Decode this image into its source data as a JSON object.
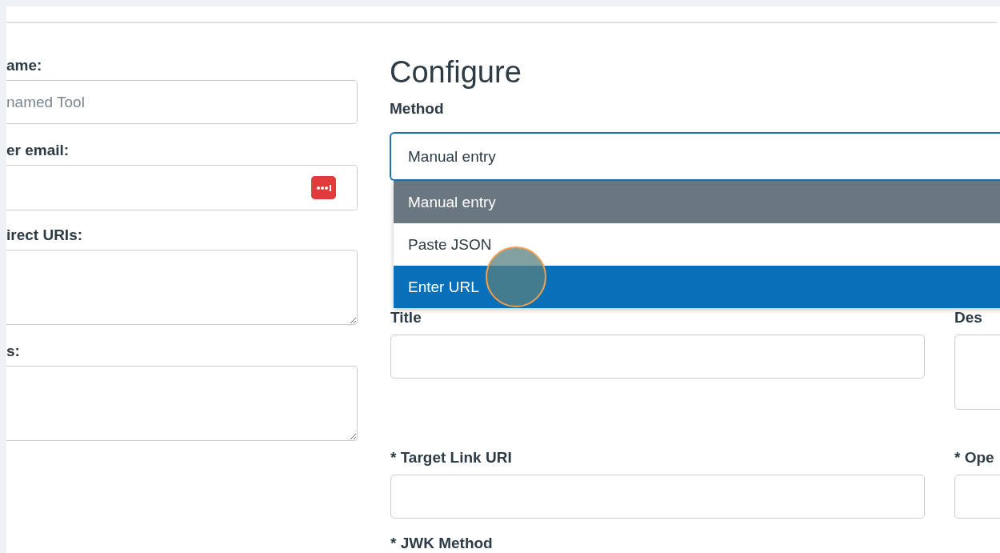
{
  "left_form": {
    "fields": [
      {
        "label": "ame:",
        "kind": "text",
        "placeholder": "named Tool"
      },
      {
        "label": "er email:",
        "kind": "email"
      },
      {
        "label": "irect URIs:",
        "kind": "textarea"
      },
      {
        "label": "s:",
        "kind": "textarea"
      }
    ]
  },
  "configure": {
    "heading": "Configure",
    "method": {
      "label": "Method",
      "value": "Manual entry",
      "expanded": true,
      "options": [
        {
          "label": "Manual entry",
          "selected": true,
          "hovered": false
        },
        {
          "label": "Paste JSON",
          "selected": false,
          "hovered": false
        },
        {
          "label": "Enter URL",
          "selected": false,
          "hovered": true
        }
      ]
    },
    "fields": [
      {
        "label": "Title",
        "kind": "text"
      },
      {
        "label": "Des",
        "kind": "textarea"
      },
      {
        "label": "* Target Link URI",
        "kind": "text"
      },
      {
        "label": "* Ope",
        "kind": "text"
      },
      {
        "label": "* JWK Method",
        "kind": "label_only"
      }
    ]
  }
}
